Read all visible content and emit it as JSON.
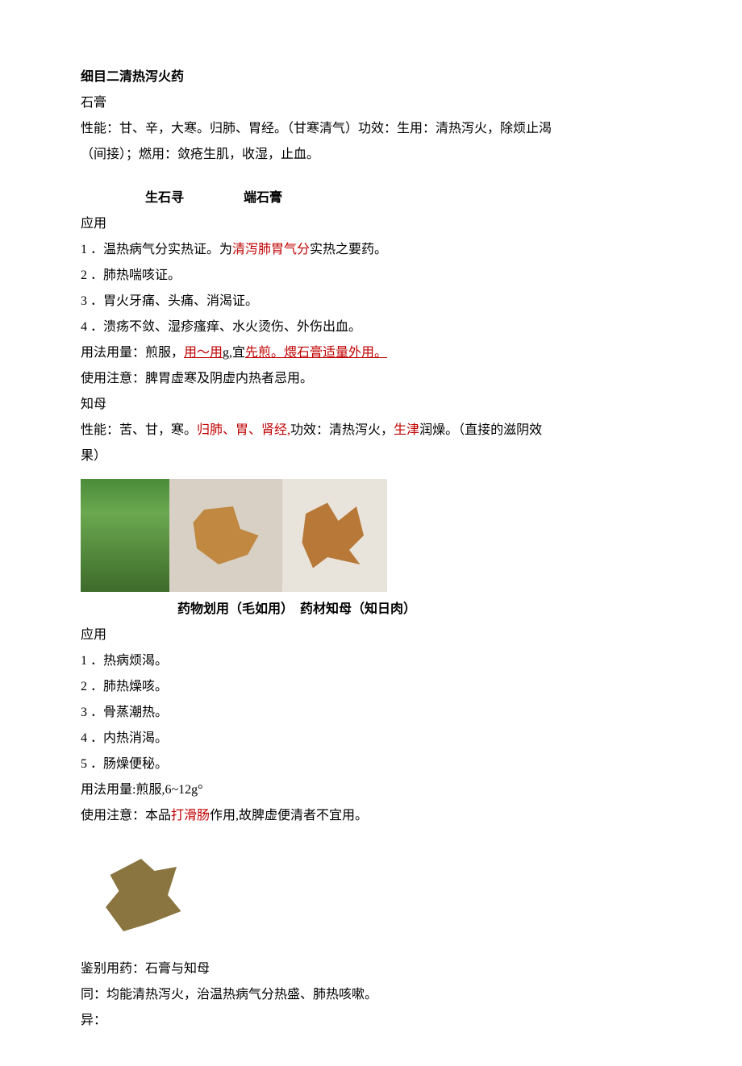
{
  "title": "细目二清热泻火药",
  "section1": {
    "name": "石膏",
    "props_label": "性能：",
    "props_text1": "甘、辛，大寒。归肺、胃经。（甘寒清气）功效：生用：清热泻火，除烦止渴",
    "props_text2": "（间接）；燃用：敛疮生肌，收湿，止血。",
    "labels": {
      "raw": "生石寻",
      "calcined": "端石膏"
    },
    "app_heading": "应用",
    "apps": {
      "a1_pre": "1 ．温热病气分实热证。为",
      "a1_red": "清泻肺胃气分",
      "a1_post": "实热之要药。",
      "a2": "2 ．肺热喘咳证。",
      "a3": "3 ．胃火牙痛、头痛、消渴证。",
      "a4": "4 ．溃疡不敛、湿疹瘙痒、水火烫伤、外伤出血。"
    },
    "dosage_pre": "用法用量：煎服，",
    "dosage_red1": "用～用",
    "dosage_mid": "g,宜",
    "dosage_red2": "先煎。煨石膏适量外用。",
    "caution": "使用注意：脾胃虚寒及阴虚内热者忌用。"
  },
  "section2": {
    "name": "知母",
    "props_pre": "性能：苦、甘，寒。",
    "props_red1": "归肺、胃、肾经,",
    "props_mid": "功效：清热泻火，",
    "props_red2": "生津",
    "props_post1": "润燥。（直接的滋阴效",
    "props_post2": "果）",
    "caption": "药物划用（毛如用）　药材知母（知日肉）",
    "app_heading": "应用",
    "apps": {
      "b1": "1 ．热病烦渴。",
      "b2": "2 ．肺热燥咳。",
      "b3": "3 ．骨蒸潮热。",
      "b4": "4 ．内热消渴。",
      "b5": "5 ．肠燥便秘。"
    },
    "dosage": "用法用量:煎服,6~12g°",
    "caution_pre": "使用注意：本品",
    "caution_red": "打滑肠",
    "caution_post": "作用,故脾虚便清者不宜用。"
  },
  "compare": {
    "heading": "鉴别用药：石膏与知母",
    "same": "同：均能清热泻火，治温热病气分热盛、肺热咳嗽。",
    "diff": "异："
  }
}
